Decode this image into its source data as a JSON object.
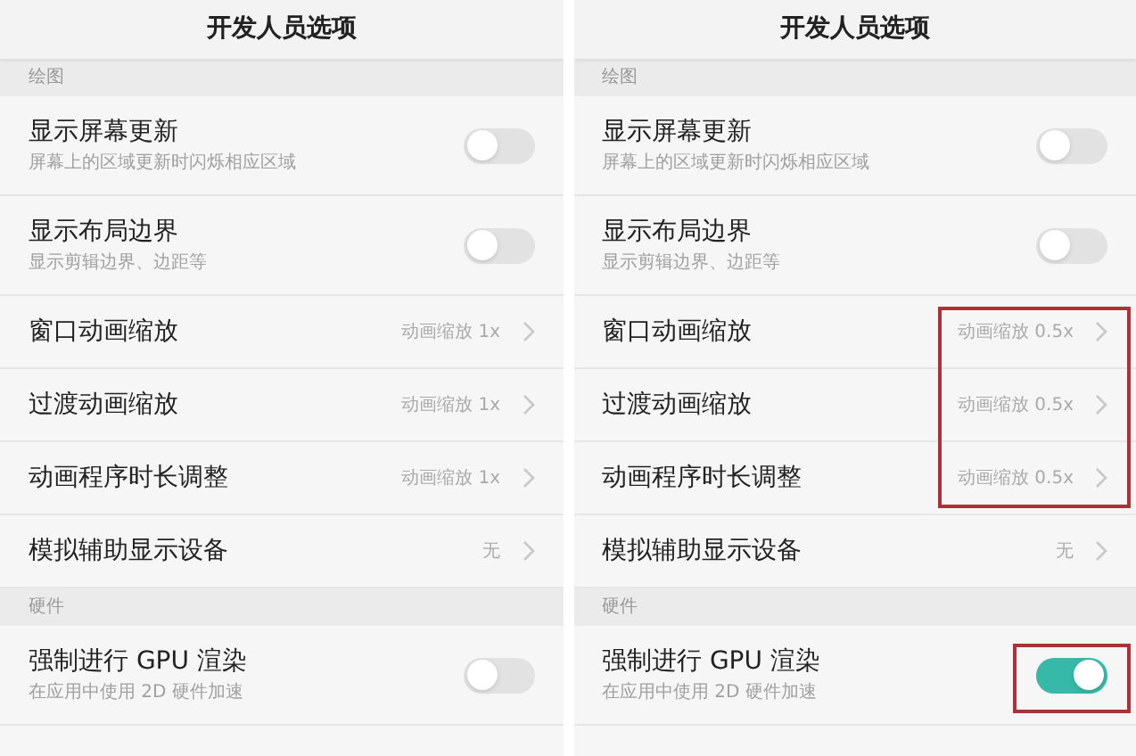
{
  "panels": [
    {
      "title": "开发人员选项",
      "sections": [
        {
          "label": "绘图",
          "items": [
            {
              "kind": "toggle",
              "title": "显示屏幕更新",
              "subtitle": "屏幕上的区域更新时闪烁相应区域",
              "on": false,
              "highlighted": false
            },
            {
              "kind": "toggle",
              "title": "显示布局边界",
              "subtitle": "显示剪辑边界、边距等",
              "on": false,
              "highlighted": false
            },
            {
              "kind": "value",
              "title": "窗口动画缩放",
              "value": "动画缩放 1x",
              "highlighted": false
            },
            {
              "kind": "value",
              "title": "过渡动画缩放",
              "value": "动画缩放 1x",
              "highlighted": false
            },
            {
              "kind": "value",
              "title": "动画程序时长调整",
              "value": "动画缩放 1x",
              "highlighted": false
            },
            {
              "kind": "value",
              "title": "模拟辅助显示设备",
              "value": "无",
              "highlighted": false
            }
          ]
        },
        {
          "label": "硬件",
          "items": [
            {
              "kind": "toggle",
              "title": "强制进行 GPU 渲染",
              "subtitle": "在应用中使用 2D 硬件加速",
              "on": false,
              "highlighted": false
            }
          ]
        }
      ]
    },
    {
      "title": "开发人员选项",
      "sections": [
        {
          "label": "绘图",
          "items": [
            {
              "kind": "toggle",
              "title": "显示屏幕更新",
              "subtitle": "屏幕上的区域更新时闪烁相应区域",
              "on": false,
              "highlighted": false
            },
            {
              "kind": "toggle",
              "title": "显示布局边界",
              "subtitle": "显示剪辑边界、边距等",
              "on": false,
              "highlighted": false
            },
            {
              "kind": "value",
              "title": "窗口动画缩放",
              "value": "动画缩放 0.5x",
              "highlighted": true
            },
            {
              "kind": "value",
              "title": "过渡动画缩放",
              "value": "动画缩放 0.5x",
              "highlighted": true
            },
            {
              "kind": "value",
              "title": "动画程序时长调整",
              "value": "动画缩放 0.5x",
              "highlighted": true
            },
            {
              "kind": "value",
              "title": "模拟辅助显示设备",
              "value": "无",
              "highlighted": false
            }
          ]
        },
        {
          "label": "硬件",
          "items": [
            {
              "kind": "toggle",
              "title": "强制进行 GPU 渲染",
              "subtitle": "在应用中使用 2D 硬件加速",
              "on": true,
              "highlighted": true
            }
          ]
        }
      ]
    }
  ]
}
